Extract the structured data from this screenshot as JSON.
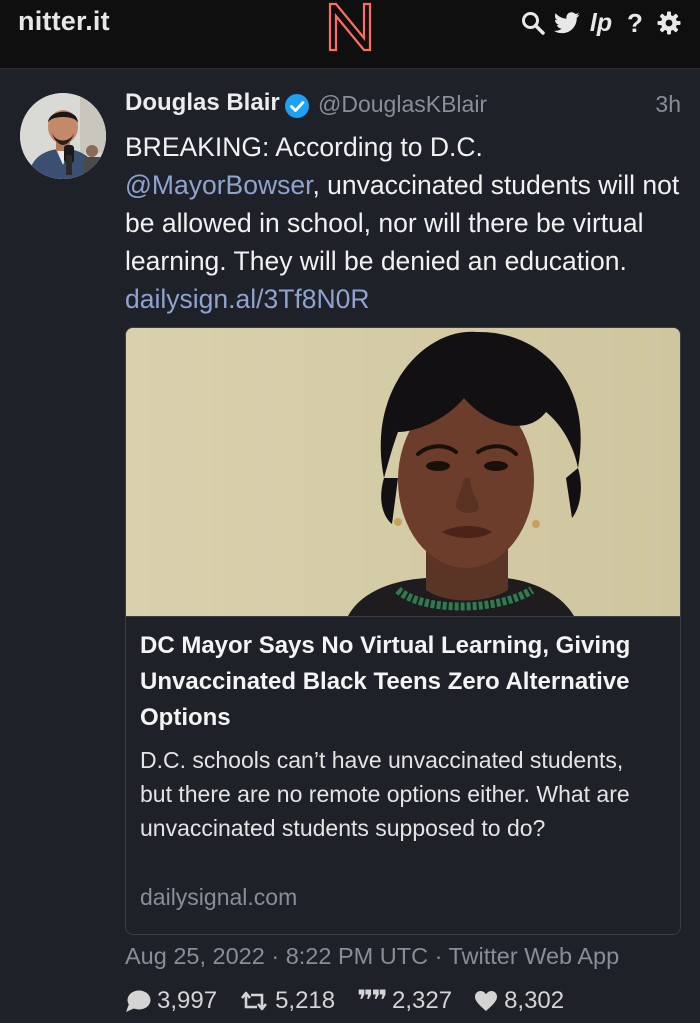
{
  "navbar": {
    "brand": "nitter.it",
    "icons": [
      "search-icon",
      "twitter-bird-icon",
      "rss-icon",
      "help-icon",
      "settings-icon"
    ],
    "help_glyph": "?",
    "rss_glyph": "lp"
  },
  "tweet": {
    "fullname": "Douglas Blair",
    "username": "@DouglasKBlair",
    "time": "3h",
    "text_before_mention": "BREAKING: According to D.C. ",
    "mention": "@MayorBowser",
    "text_after_mention": ", unvaccinated students will not be allowed in school, nor will there be virtual learning. They will be denied an education. ",
    "link": "dailysign.al/3Tf8N0R",
    "published": "Aug 25, 2022 · 8:22 PM UTC · Twitter Web App"
  },
  "card": {
    "title": "DC Mayor Says No Virtual Learning, Giving Unvaccinated Black Teens Zero Alternative Options",
    "description": "D.C. schools can’t have unvaccinated students, but there are no remote options either. What are unvaccinated students supposed to do?",
    "destination": "dailysignal.com"
  },
  "stats": {
    "replies": "3,997",
    "retweets": "5,218",
    "quotes": "2,327",
    "likes": "8,302",
    "quote_glyph": "❞❞"
  },
  "colors": {
    "background": "#1f2129",
    "navbar": "#0f0f0f",
    "accent": "#ff6c60",
    "link": "#8fa3ce",
    "verified": "#1da1f2",
    "muted": "#8a8d98"
  }
}
